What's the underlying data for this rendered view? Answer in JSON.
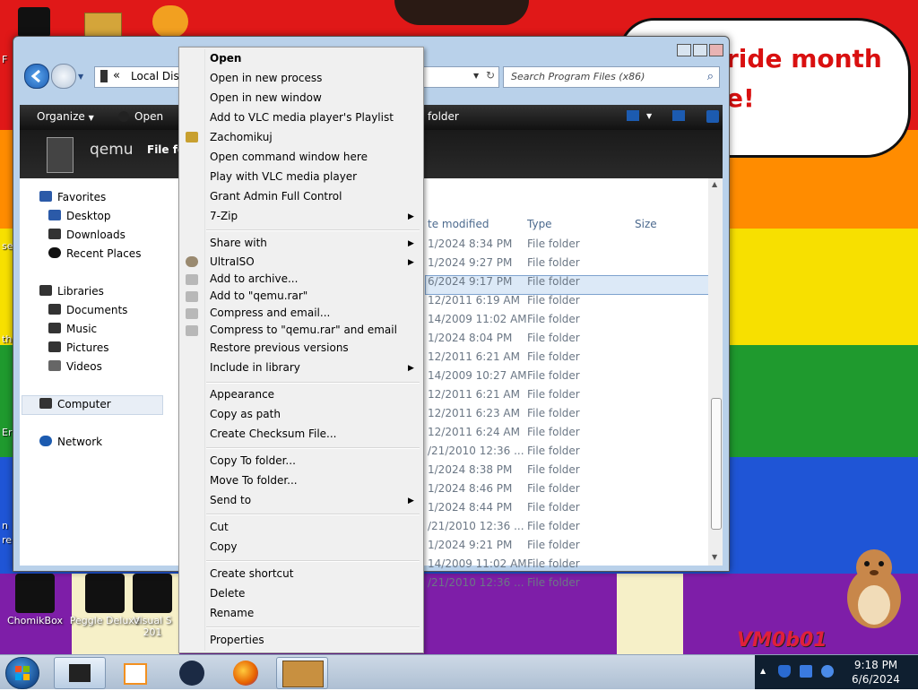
{
  "colors": {
    "rainbow": [
      "#e01818",
      "#ff8c00",
      "#f7e000",
      "#1f9a2e",
      "#1f55d6",
      "#7e1ea8"
    ],
    "menu_bg": "#f0f0f0",
    "selection": "#dce9f7",
    "taskbar": "#b9cbe0"
  },
  "desktop": {
    "bubble_line1": "ride month",
    "bubble_line2": "e!",
    "edge_labels": [
      "F",
      "se",
      "th",
      "Er",
      "n",
      "re"
    ],
    "icons": [
      {
        "label": "ChomikBox",
        "icon": "chomikbox-icon"
      },
      {
        "label": "Peggle Deluxe",
        "icon": "peggle-icon"
      },
      {
        "label": "Visual S",
        "icon": "visual-studio-icon"
      }
    ],
    "visual_sub": "201",
    "watermark": "VM0b01"
  },
  "explorer": {
    "address": "Local Disk",
    "address_prefix": "«",
    "search_placeholder": "Search Program Files (x86)",
    "toolbar": {
      "organize": "Organize",
      "open": "Open",
      "new_folder": "folder"
    },
    "banner_title": "qemu",
    "banner_sub": "File fo",
    "nav": {
      "favorites": "Favorites",
      "desktop": "Desktop",
      "downloads": "Downloads",
      "recent": "Recent Places",
      "libraries": "Libraries",
      "documents": "Documents",
      "music": "Music",
      "pictures": "Pictures",
      "videos": "Videos",
      "computer": "Computer",
      "network": "Network"
    },
    "columns": {
      "date": "te modified",
      "type": "Type",
      "size": "Size"
    },
    "rows": [
      {
        "date": "1/2024 8:34 PM",
        "type": "File folder"
      },
      {
        "date": "1/2024 9:27 PM",
        "type": "File folder"
      },
      {
        "date": "6/2024 9:17 PM",
        "type": "File folder"
      },
      {
        "date": "12/2011 6:19 AM",
        "type": "File folder"
      },
      {
        "date": "14/2009 11:02 AM",
        "type": "File folder"
      },
      {
        "date": "1/2024 8:04 PM",
        "type": "File folder"
      },
      {
        "date": "12/2011 6:21 AM",
        "type": "File folder"
      },
      {
        "date": "14/2009 10:27 AM",
        "type": "File folder"
      },
      {
        "date": "12/2011 6:21 AM",
        "type": "File folder"
      },
      {
        "date": "12/2011 6:23 AM",
        "type": "File folder"
      },
      {
        "date": "12/2011 6:24 AM",
        "type": "File folder"
      },
      {
        "date": "/21/2010 12:36 ...",
        "type": "File folder"
      },
      {
        "date": "1/2024 8:38 PM",
        "type": "File folder"
      },
      {
        "date": "1/2024 8:46 PM",
        "type": "File folder"
      },
      {
        "date": "1/2024 8:44 PM",
        "type": "File folder"
      },
      {
        "date": "/21/2010 12:36 ...",
        "type": "File folder"
      },
      {
        "date": "1/2024 9:21 PM",
        "type": "File folder"
      },
      {
        "date": "14/2009 11:02 AM",
        "type": "File folder"
      },
      {
        "date": "/21/2010 12:36 ...",
        "type": "File folder"
      }
    ]
  },
  "context_menu": {
    "open": "Open",
    "open_new_process": "Open in new process",
    "open_new_window": "Open in new window",
    "vlc_playlist": "Add to VLC media player's Playlist",
    "zachomikuj": "Zachomikuj",
    "open_cmd": "Open command window here",
    "vlc_play": "Play with VLC media player",
    "grant_admin": "Grant Admin Full Control",
    "sevenzip": "7-Zip",
    "share_with": "Share with",
    "ultraiso": "UltraISO",
    "add_archive": "Add to archive...",
    "add_qemu_rar": "Add to \"qemu.rar\"",
    "compress_email": "Compress and email...",
    "compress_qemu_email": "Compress to \"qemu.rar\" and email",
    "restore": "Restore previous versions",
    "include_library": "Include in library",
    "appearance": "Appearance",
    "copy_path": "Copy as path",
    "checksum": "Create Checksum File...",
    "copy_to": "Copy To folder...",
    "move_to": "Move To folder...",
    "send_to": "Send to",
    "cut": "Cut",
    "copy": "Copy",
    "create_shortcut": "Create shortcut",
    "delete": "Delete",
    "rename": "Rename",
    "properties": "Properties"
  },
  "taskbar": {
    "apps": [
      "explorer-icon",
      "media-player-icon",
      "steam-icon",
      "firefox-icon",
      "chomikbox-icon"
    ],
    "time": "9:18 PM",
    "date": "6/6/2024"
  }
}
